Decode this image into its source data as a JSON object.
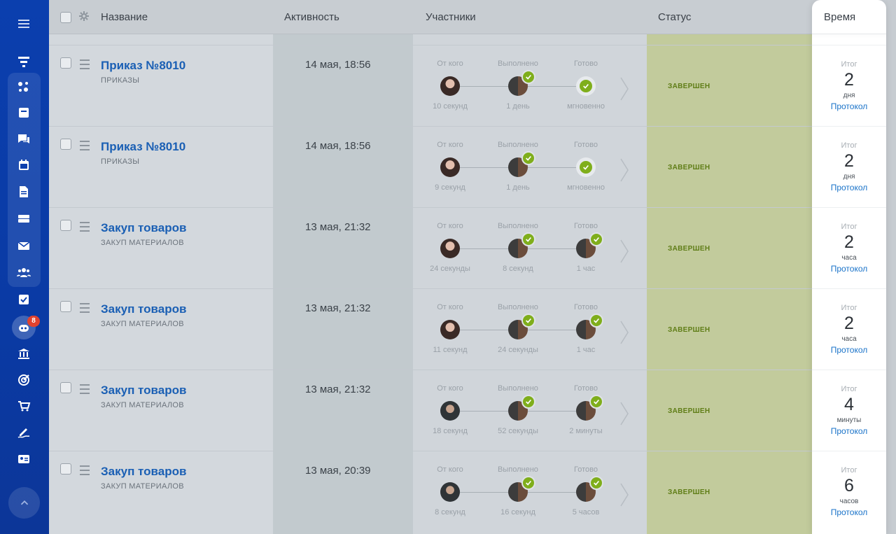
{
  "header": {
    "name": "Название",
    "activity": "Активность",
    "participants": "Участники",
    "status": "Статус",
    "time": "Время"
  },
  "participant_labels": {
    "from": "От кого",
    "done": "Выполнено",
    "ready": "Готово"
  },
  "sidebar": {
    "badge": "8"
  },
  "colors": {
    "accent": "#1a5fb4",
    "status_green": "#7fae1b",
    "sidebar": "#0b3fae"
  },
  "rows": [
    {
      "title": "Приказ №8010",
      "subtitle": "ПРИКАЗЫ",
      "activity": "14 мая, 18:56",
      "t1": "10 секунд",
      "t2": "1 день",
      "t3": "мгновенно",
      "status": "ЗАВЕРШЕН",
      "itog": "Итог",
      "num": "2",
      "unit": "дня",
      "link": "Протокол"
    },
    {
      "title": "Приказ №8010",
      "subtitle": "ПРИКАЗЫ",
      "activity": "14 мая, 18:56",
      "t1": "9 секунд",
      "t2": "1 день",
      "t3": "мгновенно",
      "status": "ЗАВЕРШЕН",
      "itog": "Итог",
      "num": "2",
      "unit": "дня",
      "link": "Протокол"
    },
    {
      "title": "Закуп товаров",
      "subtitle": "ЗАКУП МАТЕРИАЛОВ",
      "activity": "13 мая, 21:32",
      "t1": "24 секунды",
      "t2": "8 секунд",
      "t3": "1 час",
      "status": "ЗАВЕРШЕН",
      "itog": "Итог",
      "num": "2",
      "unit": "часа",
      "link": "Протокол"
    },
    {
      "title": "Закуп товаров",
      "subtitle": "ЗАКУП МАТЕРИАЛОВ",
      "activity": "13 мая, 21:32",
      "t1": "11 секунд",
      "t2": "24 секунды",
      "t3": "1 час",
      "status": "ЗАВЕРШЕН",
      "itog": "Итог",
      "num": "2",
      "unit": "часа",
      "link": "Протокол"
    },
    {
      "title": "Закуп товаров",
      "subtitle": "ЗАКУП МАТЕРИАЛОВ",
      "activity": "13 мая, 21:32",
      "t1": "18 секунд",
      "t2": "52 секунды",
      "t3": "2 минуты",
      "status": "ЗАВЕРШЕН",
      "itog": "Итог",
      "num": "4",
      "unit": "минуты",
      "link": "Протокол"
    },
    {
      "title": "Закуп товаров",
      "subtitle": "ЗАКУП МАТЕРИАЛОВ",
      "activity": "13 мая, 20:39",
      "t1": "8 секунд",
      "t2": "16 секунд",
      "t3": "5 часов",
      "status": "ЗАВЕРШЕН",
      "itog": "Итог",
      "num": "6",
      "unit": "часов",
      "link": "Протокол"
    }
  ]
}
